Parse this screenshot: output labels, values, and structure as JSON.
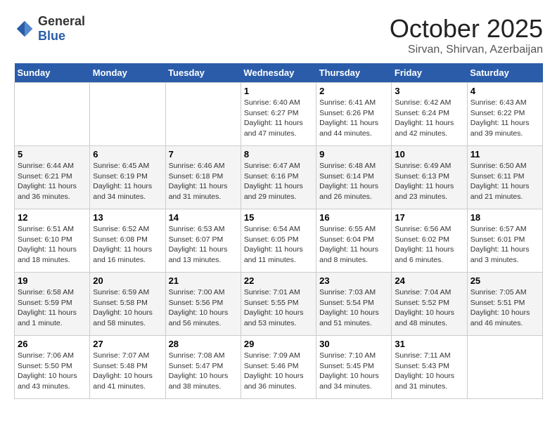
{
  "header": {
    "logo_general": "General",
    "logo_blue": "Blue",
    "month": "October 2025",
    "location": "Sirvan, Shirvan, Azerbaijan"
  },
  "calendar": {
    "days_of_week": [
      "Sunday",
      "Monday",
      "Tuesday",
      "Wednesday",
      "Thursday",
      "Friday",
      "Saturday"
    ],
    "weeks": [
      [
        {
          "day": "",
          "info": ""
        },
        {
          "day": "",
          "info": ""
        },
        {
          "day": "",
          "info": ""
        },
        {
          "day": "1",
          "info": "Sunrise: 6:40 AM\nSunset: 6:27 PM\nDaylight: 11 hours and 47 minutes."
        },
        {
          "day": "2",
          "info": "Sunrise: 6:41 AM\nSunset: 6:26 PM\nDaylight: 11 hours and 44 minutes."
        },
        {
          "day": "3",
          "info": "Sunrise: 6:42 AM\nSunset: 6:24 PM\nDaylight: 11 hours and 42 minutes."
        },
        {
          "day": "4",
          "info": "Sunrise: 6:43 AM\nSunset: 6:22 PM\nDaylight: 11 hours and 39 minutes."
        }
      ],
      [
        {
          "day": "5",
          "info": "Sunrise: 6:44 AM\nSunset: 6:21 PM\nDaylight: 11 hours and 36 minutes."
        },
        {
          "day": "6",
          "info": "Sunrise: 6:45 AM\nSunset: 6:19 PM\nDaylight: 11 hours and 34 minutes."
        },
        {
          "day": "7",
          "info": "Sunrise: 6:46 AM\nSunset: 6:18 PM\nDaylight: 11 hours and 31 minutes."
        },
        {
          "day": "8",
          "info": "Sunrise: 6:47 AM\nSunset: 6:16 PM\nDaylight: 11 hours and 29 minutes."
        },
        {
          "day": "9",
          "info": "Sunrise: 6:48 AM\nSunset: 6:14 PM\nDaylight: 11 hours and 26 minutes."
        },
        {
          "day": "10",
          "info": "Sunrise: 6:49 AM\nSunset: 6:13 PM\nDaylight: 11 hours and 23 minutes."
        },
        {
          "day": "11",
          "info": "Sunrise: 6:50 AM\nSunset: 6:11 PM\nDaylight: 11 hours and 21 minutes."
        }
      ],
      [
        {
          "day": "12",
          "info": "Sunrise: 6:51 AM\nSunset: 6:10 PM\nDaylight: 11 hours and 18 minutes."
        },
        {
          "day": "13",
          "info": "Sunrise: 6:52 AM\nSunset: 6:08 PM\nDaylight: 11 hours and 16 minutes."
        },
        {
          "day": "14",
          "info": "Sunrise: 6:53 AM\nSunset: 6:07 PM\nDaylight: 11 hours and 13 minutes."
        },
        {
          "day": "15",
          "info": "Sunrise: 6:54 AM\nSunset: 6:05 PM\nDaylight: 11 hours and 11 minutes."
        },
        {
          "day": "16",
          "info": "Sunrise: 6:55 AM\nSunset: 6:04 PM\nDaylight: 11 hours and 8 minutes."
        },
        {
          "day": "17",
          "info": "Sunrise: 6:56 AM\nSunset: 6:02 PM\nDaylight: 11 hours and 6 minutes."
        },
        {
          "day": "18",
          "info": "Sunrise: 6:57 AM\nSunset: 6:01 PM\nDaylight: 11 hours and 3 minutes."
        }
      ],
      [
        {
          "day": "19",
          "info": "Sunrise: 6:58 AM\nSunset: 5:59 PM\nDaylight: 11 hours and 1 minute."
        },
        {
          "day": "20",
          "info": "Sunrise: 6:59 AM\nSunset: 5:58 PM\nDaylight: 10 hours and 58 minutes."
        },
        {
          "day": "21",
          "info": "Sunrise: 7:00 AM\nSunset: 5:56 PM\nDaylight: 10 hours and 56 minutes."
        },
        {
          "day": "22",
          "info": "Sunrise: 7:01 AM\nSunset: 5:55 PM\nDaylight: 10 hours and 53 minutes."
        },
        {
          "day": "23",
          "info": "Sunrise: 7:03 AM\nSunset: 5:54 PM\nDaylight: 10 hours and 51 minutes."
        },
        {
          "day": "24",
          "info": "Sunrise: 7:04 AM\nSunset: 5:52 PM\nDaylight: 10 hours and 48 minutes."
        },
        {
          "day": "25",
          "info": "Sunrise: 7:05 AM\nSunset: 5:51 PM\nDaylight: 10 hours and 46 minutes."
        }
      ],
      [
        {
          "day": "26",
          "info": "Sunrise: 7:06 AM\nSunset: 5:50 PM\nDaylight: 10 hours and 43 minutes."
        },
        {
          "day": "27",
          "info": "Sunrise: 7:07 AM\nSunset: 5:48 PM\nDaylight: 10 hours and 41 minutes."
        },
        {
          "day": "28",
          "info": "Sunrise: 7:08 AM\nSunset: 5:47 PM\nDaylight: 10 hours and 38 minutes."
        },
        {
          "day": "29",
          "info": "Sunrise: 7:09 AM\nSunset: 5:46 PM\nDaylight: 10 hours and 36 minutes."
        },
        {
          "day": "30",
          "info": "Sunrise: 7:10 AM\nSunset: 5:45 PM\nDaylight: 10 hours and 34 minutes."
        },
        {
          "day": "31",
          "info": "Sunrise: 7:11 AM\nSunset: 5:43 PM\nDaylight: 10 hours and 31 minutes."
        },
        {
          "day": "",
          "info": ""
        }
      ]
    ]
  }
}
